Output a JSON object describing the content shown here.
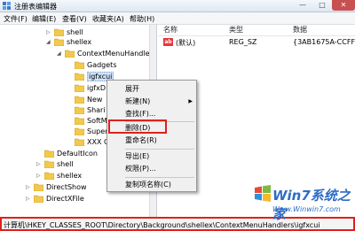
{
  "window": {
    "title": "注册表编辑器",
    "minimize": "—",
    "maximize": "□",
    "close": "✕"
  },
  "menubar": {
    "items": [
      "文件(F)",
      "编辑(E)",
      "查看(V)",
      "收藏夹(A)",
      "帮助(H)"
    ]
  },
  "tree": {
    "rows": [
      {
        "label": "shell",
        "expander": "▷"
      },
      {
        "label": "shellex",
        "expander": "◢"
      },
      {
        "label": "ContextMenuHandlers",
        "expander": "◢"
      },
      {
        "label": "Gadgets",
        "expander": ""
      },
      {
        "label": "igfxcui",
        "expander": "",
        "selected": true
      },
      {
        "label": "igfxD",
        "expander": ""
      },
      {
        "label": "New",
        "expander": ""
      },
      {
        "label": "Shari",
        "expander": ""
      },
      {
        "label": "SoftM",
        "expander": ""
      },
      {
        "label": "Super",
        "expander": ""
      },
      {
        "label": "XXX C",
        "expander": ""
      },
      {
        "label": "DefaultIcon",
        "expander": ""
      },
      {
        "label": "shell",
        "expander": "▷"
      },
      {
        "label": "shellex",
        "expander": "▷"
      },
      {
        "label": "DirectShow",
        "expander": "▷"
      },
      {
        "label": "DirectXFile",
        "expander": "▷"
      }
    ]
  },
  "list": {
    "headers": [
      "名称",
      "类型",
      "数据"
    ],
    "row": {
      "name": "(默认)",
      "type": "REG_SZ",
      "data": "{3AB1675A-CCFF-1",
      "icon": "ab"
    }
  },
  "context_menu": {
    "items": [
      {
        "label": "展开",
        "arrow": ""
      },
      {
        "label": "新建(N)",
        "arrow": "▶"
      },
      {
        "label": "查找(F)...",
        "arrow": ""
      },
      {
        "label": "删除(D)",
        "arrow": ""
      },
      {
        "label": "重命名(R)",
        "arrow": ""
      },
      {
        "label": "导出(E)",
        "arrow": ""
      },
      {
        "label": "权限(P)...",
        "arrow": ""
      },
      {
        "label": "复制项名称(C)",
        "arrow": ""
      }
    ]
  },
  "statusbar": {
    "path": "计算机\\HKEY_CLASSES_ROOT\\Directory\\Background\\shellex\\ContextMenuHandlers\\igfxcui"
  },
  "watermark": {
    "brand": "Win7系统之家",
    "url": "Www.Winwin7.com"
  },
  "colors": {
    "highlight_red": "#e0201c",
    "folder_yellow": "#f2c94c",
    "selection_blue": "#cfe3fb"
  }
}
